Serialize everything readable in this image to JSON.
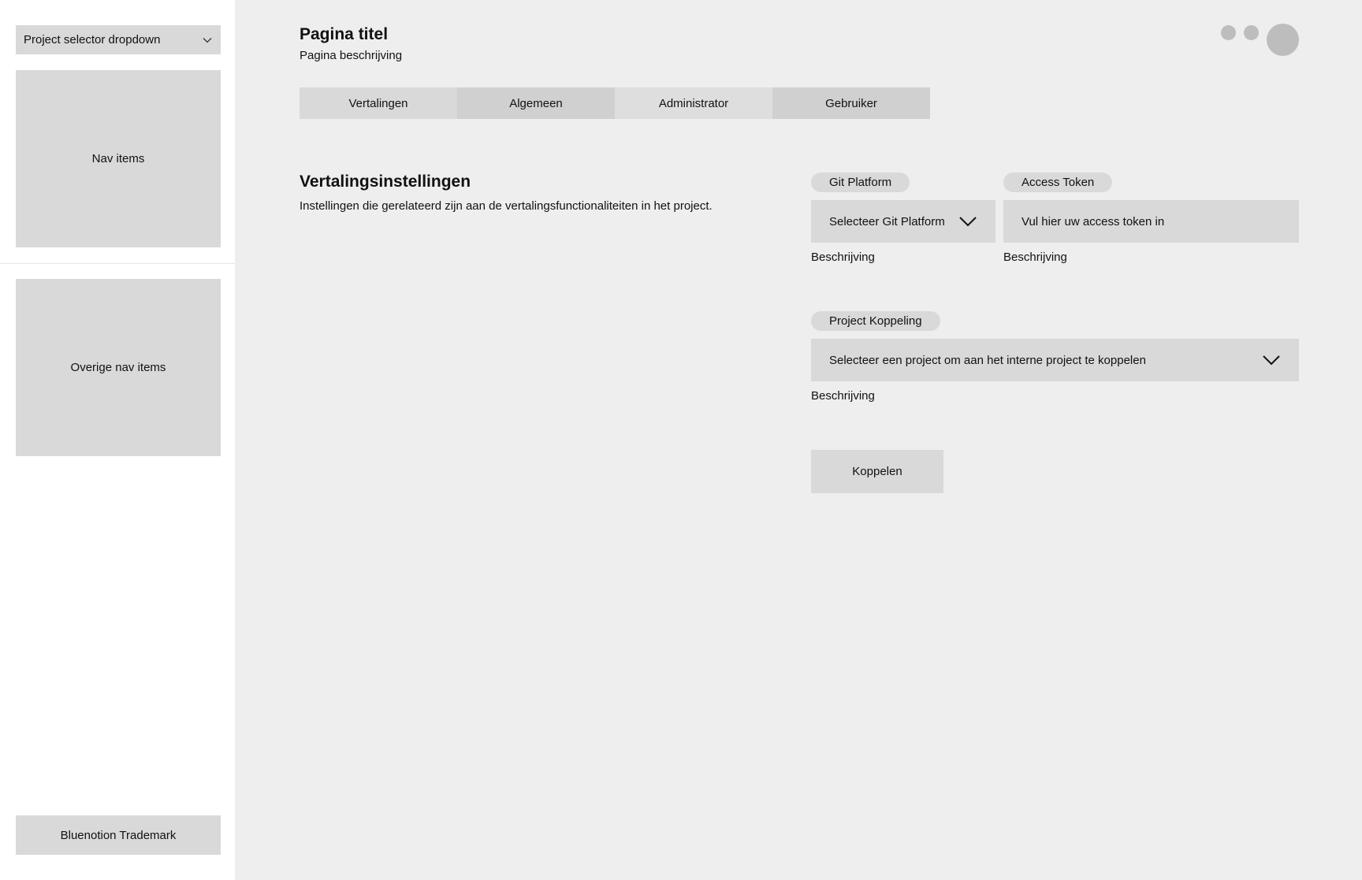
{
  "sidebar": {
    "project_selector": "Project selector dropdown",
    "nav_items": "Nav items",
    "other_nav_items": "Overige nav items",
    "trademark": "Bluenotion Trademark"
  },
  "header": {
    "title": "Pagina titel",
    "description": "Pagina beschrijving"
  },
  "tabs": [
    {
      "label": "Vertalingen"
    },
    {
      "label": "Algemeen"
    },
    {
      "label": "Administrator"
    },
    {
      "label": "Gebruiker"
    }
  ],
  "section": {
    "title": "Vertalingsinstellingen",
    "description": "Instellingen die gerelateerd zijn aan de vertalingsfunctionaliteiten in het project."
  },
  "form": {
    "git_platform": {
      "label": "Git Platform",
      "value": "Selecteer Git Platform",
      "helper": "Beschrijving"
    },
    "access_token": {
      "label": "Access Token",
      "placeholder": "Vul hier uw access token in",
      "helper": "Beschrijving"
    },
    "project_link": {
      "label": "Project Koppeling",
      "value": "Selecteer een project om aan het interne project te koppelen",
      "helper": "Beschrijving"
    },
    "submit_label": "Koppelen"
  }
}
